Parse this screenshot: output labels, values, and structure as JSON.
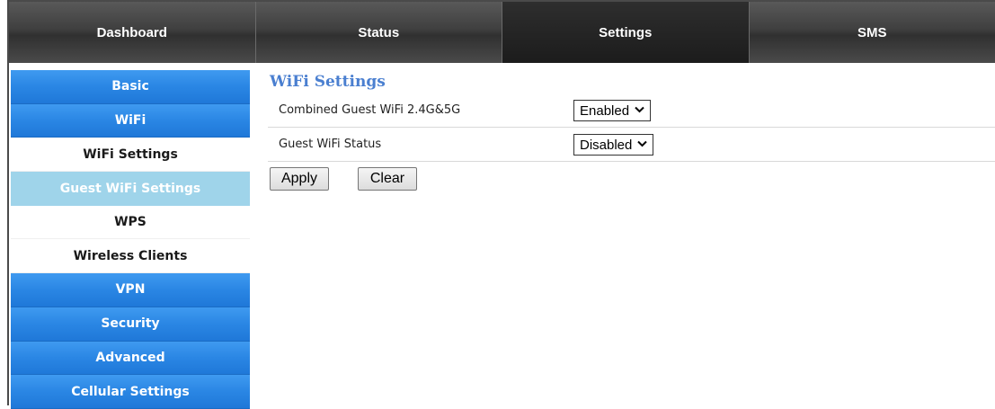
{
  "topnav": {
    "tabs": [
      {
        "label": "Dashboard",
        "active": false
      },
      {
        "label": "Status",
        "active": false
      },
      {
        "label": "Settings",
        "active": true
      },
      {
        "label": "SMS",
        "active": false
      }
    ]
  },
  "sidebar": {
    "items": [
      {
        "label": "Basic",
        "style": "blue"
      },
      {
        "label": "WiFi",
        "style": "blue"
      },
      {
        "label": "WiFi Settings",
        "style": "white"
      },
      {
        "label": "Guest WiFi Settings",
        "style": "selected"
      },
      {
        "label": "WPS",
        "style": "white"
      },
      {
        "label": "Wireless Clients",
        "style": "white"
      },
      {
        "label": "VPN",
        "style": "blue"
      },
      {
        "label": "Security",
        "style": "blue"
      },
      {
        "label": "Advanced",
        "style": "blue"
      },
      {
        "label": "Cellular Settings",
        "style": "blue"
      }
    ]
  },
  "main": {
    "title": "WiFi Settings",
    "fields": [
      {
        "label": "Combined Guest WiFi 2.4G&5G",
        "value": "Enabled"
      },
      {
        "label": "Guest WiFi Status",
        "value": "Disabled"
      }
    ],
    "apply_label": "Apply",
    "clear_label": "Clear"
  },
  "colors": {
    "accent_blue": "#2a86e4",
    "selected_item": "#9fd4ea",
    "title_blue": "#4a7fd0",
    "nav_dark": "#3f3f3f"
  }
}
